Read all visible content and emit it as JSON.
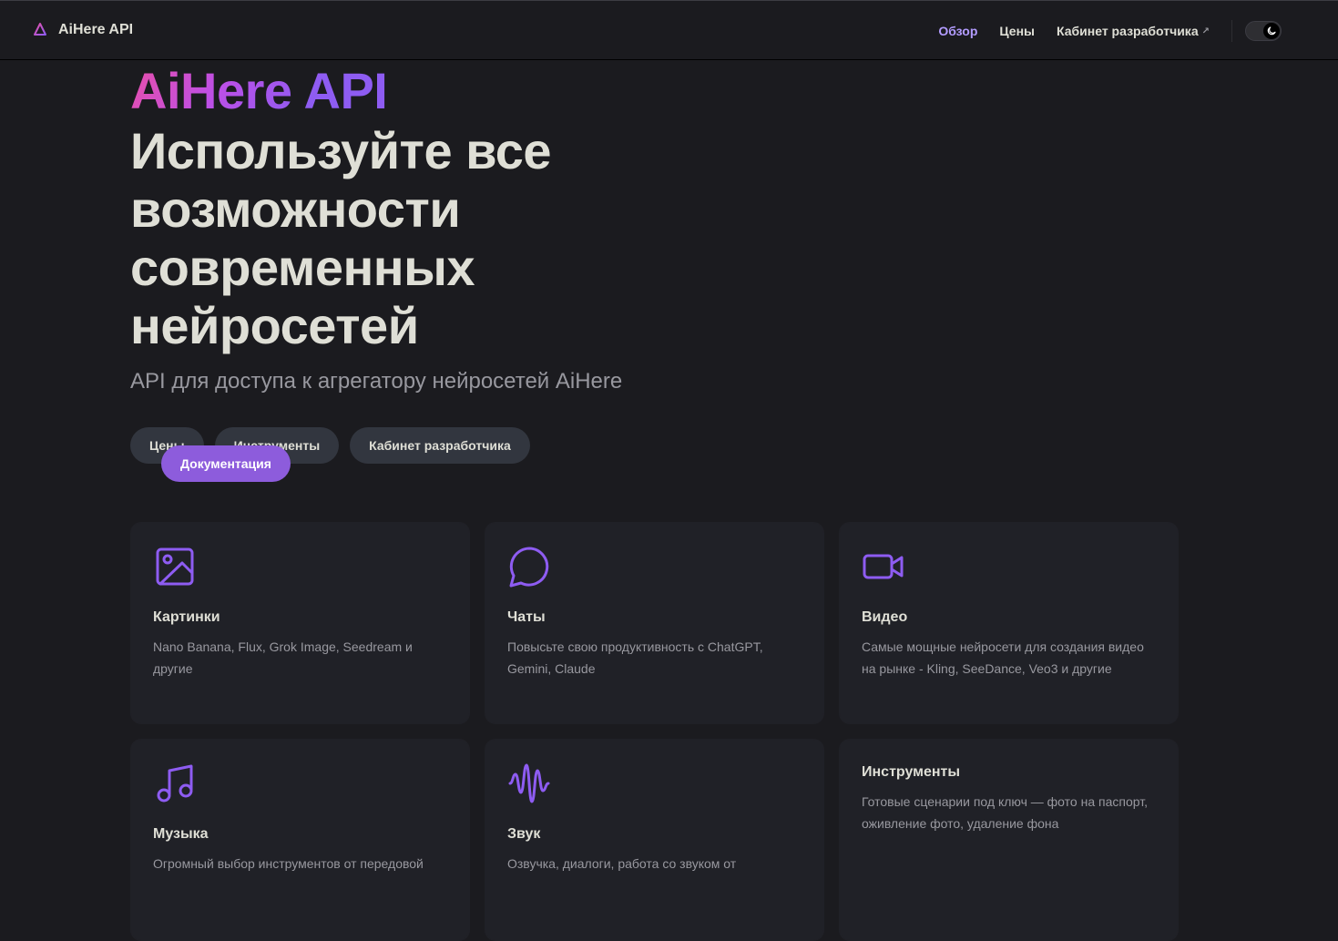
{
  "nav": {
    "brand_title": "AiHere API",
    "links": [
      {
        "label": "Обзор",
        "active": true
      },
      {
        "label": "Цены",
        "active": false
      },
      {
        "label": "Кабинет разработчика",
        "external": true
      }
    ],
    "external_arrow": "↗",
    "appearance_toggle_icon": "moon-icon"
  },
  "hero": {
    "name": "AiHere API",
    "text": "Используйте все возможности современных нейросетей",
    "tagline": "API для доступа к агрегатору нейросетей AiHere",
    "actions": [
      {
        "label": "Документация",
        "theme": "brand"
      },
      {
        "label": "Цены",
        "theme": "alt"
      },
      {
        "label": "Инструменты",
        "theme": "alt"
      },
      {
        "label": "Кабинет разработчика",
        "theme": "alt"
      }
    ]
  },
  "features": [
    {
      "icon": "image-icon",
      "title": "Картинки",
      "details": "Nano Banana, Flux, Grok Image, Seedream и другие"
    },
    {
      "icon": "chat-bubble-icon",
      "title": "Чаты",
      "details": "Повысьте свою продуктивность с ChatGPT, Gemini, Claude"
    },
    {
      "icon": "video-camera-icon",
      "title": "Видео",
      "details": "Самые мощные нейросети для создания видео на рынке - Kling, SeeDance, Veo3 и другие"
    },
    {
      "icon": "music-note-icon",
      "title": "Музыка",
      "details": "Огромный выбор инструментов от передовой"
    },
    {
      "icon": "sound-wave-icon",
      "title": "Звук",
      "details": "Озвучка, диалоги, работа со звуком от"
    },
    {
      "icon": "",
      "title": "Инструменты",
      "details": "Готовые сценарии под ключ — фото на паспорт, оживление фото, удаление фона"
    }
  ],
  "colors": {
    "background": "#1b1b1f",
    "card": "#202127",
    "brand": "#8d5cdc",
    "icon_accent": "#8e5cf2",
    "text_primary": "#dfdfd6",
    "text_secondary": "#98989f",
    "nav_active": "#b39cff"
  }
}
